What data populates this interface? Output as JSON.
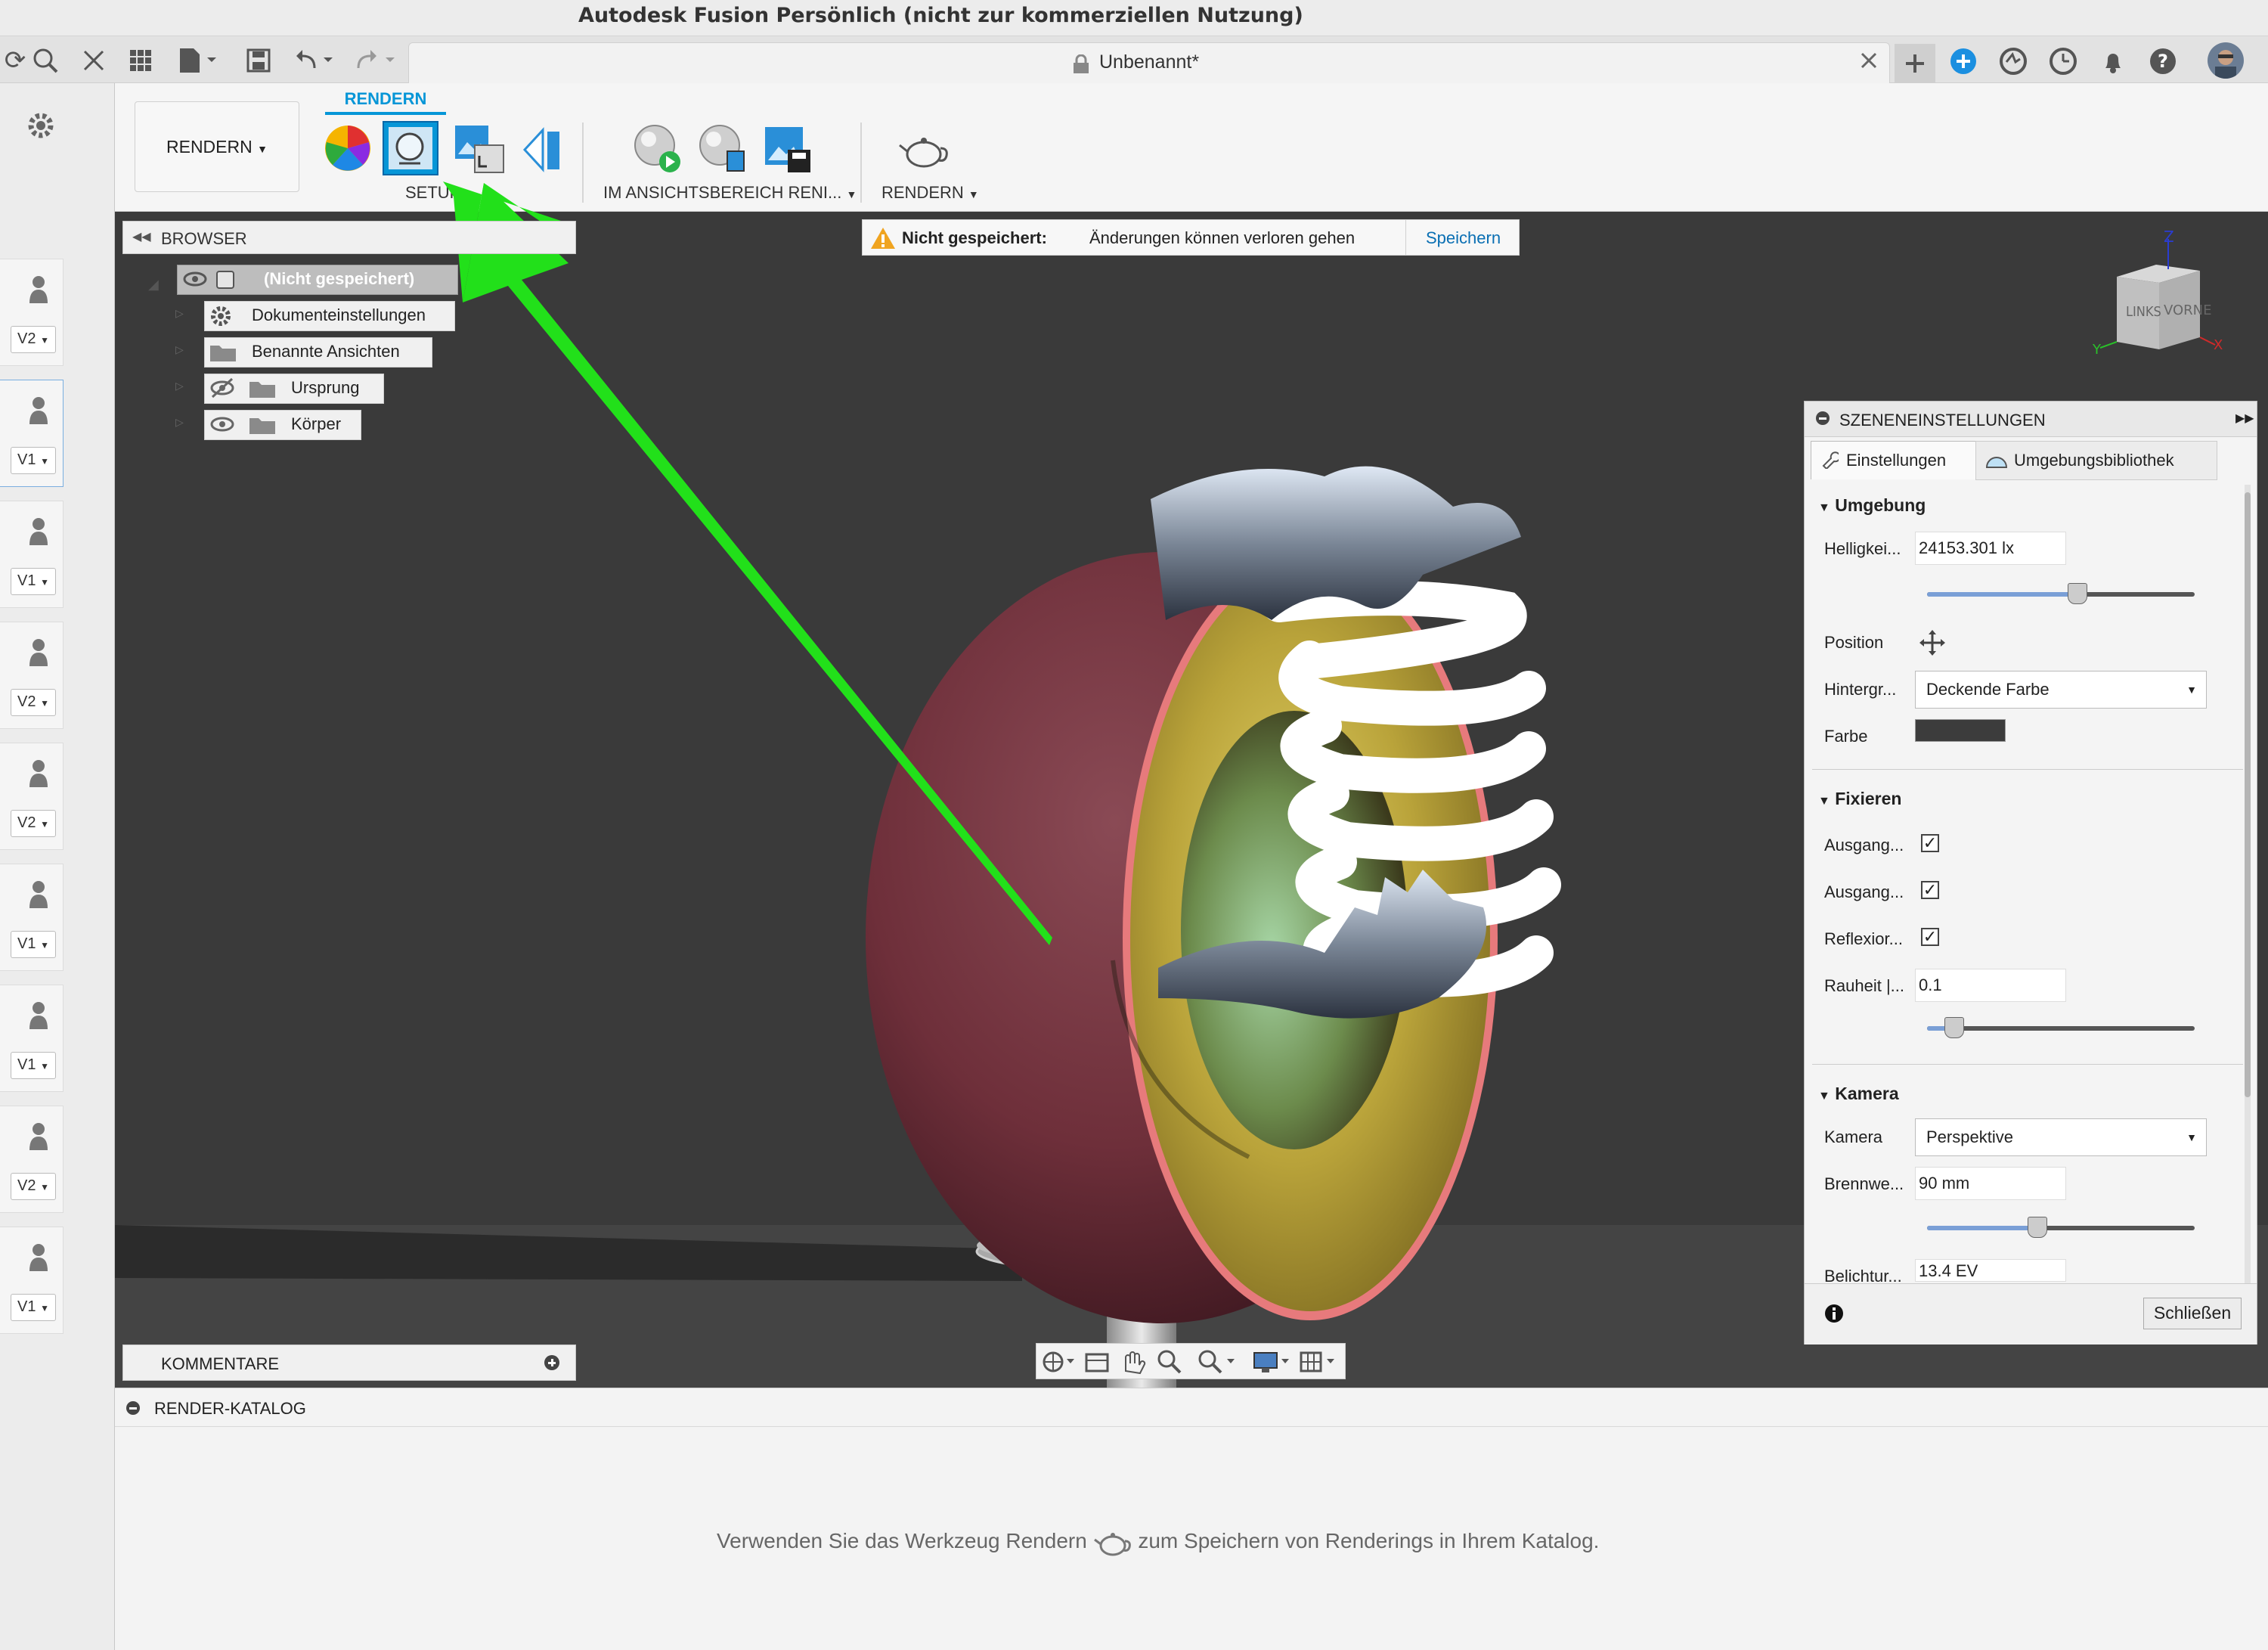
{
  "window": {
    "title": "Autodesk Fusion Persönlich (nicht zur kommerziellen Nutzung)"
  },
  "tabbar": {
    "doc_title": "Unbenannt*",
    "icons": [
      "refresh-icon",
      "search-icon",
      "close-icon",
      "grid-icon",
      "file-icon",
      "save-icon",
      "undo-icon",
      "redo-icon",
      "plus-icon",
      "add-circle-icon",
      "online-icon",
      "clock-icon",
      "bell-icon",
      "help-icon",
      "avatar"
    ]
  },
  "versions": [
    "V2",
    "V1",
    "V1",
    "V2",
    "V2",
    "V1",
    "V1",
    "V2",
    "V1"
  ],
  "toolbar": {
    "workspace": "RENDERN",
    "section_title": "RENDERN",
    "group_setup": "SETUP",
    "group_inview": "IM ANSICHTSBEREICH RENI...",
    "group_render": "RENDERN"
  },
  "browser": {
    "title": "BROWSER",
    "root": "(Nicht gespeichert)",
    "nodes": [
      "Dokumenteinstellungen",
      "Benannte Ansichten",
      "Ursprung",
      "Körper"
    ]
  },
  "warning": {
    "title": "Nicht gespeichert:",
    "message": "Änderungen können verloren gehen",
    "action": "Speichern"
  },
  "viewcube": {
    "left": "LINKS",
    "front": "VORNE",
    "z": "Z",
    "y": "Y",
    "x": "X"
  },
  "scene": {
    "title": "SZENENEINSTELLUNGEN",
    "tab_settings": "Einstellungen",
    "tab_library": "Umgebungsbibliothek",
    "environment": {
      "header": "Umgebung",
      "brightness_label": "Helligkei...",
      "brightness_value": "24153.301 lx",
      "brightness_level": 0.56,
      "position_label": "Position",
      "background_label": "Hintergr...",
      "background_value": "Deckende Farbe",
      "color_label": "Farbe",
      "color_swatch": "#3c3c3c"
    },
    "fixieren": {
      "header": "Fixieren",
      "check1_label": "Ausgang...",
      "check2_label": "Ausgang...",
      "check3_label": "Reflexior...",
      "checked_mark": "✓",
      "roughness_label": "Rauheit |...",
      "roughness_value": "0.1",
      "roughness_level": 0.1
    },
    "camera": {
      "header": "Kamera",
      "camera_label": "Kamera",
      "camera_value": "Perspektive",
      "focal_label": "Brennwe...",
      "focal_value": "90 mm",
      "focal_level": 0.41,
      "exposure_label": "Belichtur...",
      "exposure_value": "13.4 EV"
    },
    "close_button": "Schließen"
  },
  "comments": {
    "title": "KOMMENTARE"
  },
  "catalog": {
    "title": "RENDER-KATALOG",
    "hint_before": "Verwenden Sie das Werkzeug Rendern",
    "hint_after": "zum Speichern von Renderings in Ihrem Katalog."
  },
  "colors": {
    "accent": "#0696d7",
    "arrow": "#22e01a",
    "viewport_bg": "#3a3a3a"
  }
}
